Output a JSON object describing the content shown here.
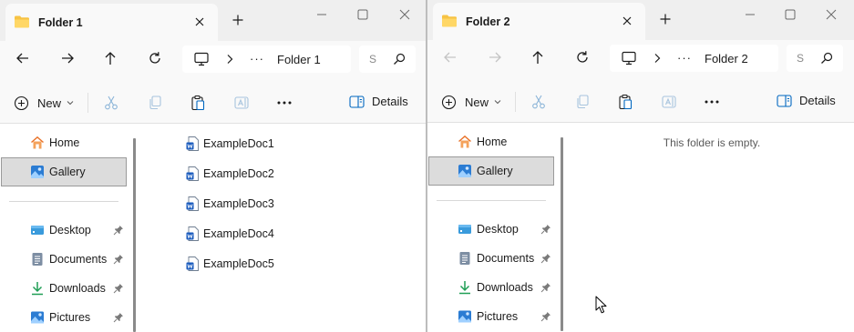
{
  "window1": {
    "tab_title": "Folder 1",
    "breadcrumb_ellipsis": "···",
    "breadcrumb_current": "Folder 1",
    "search_placeholder": "S",
    "new_label": "New",
    "details_label": "Details",
    "nav": {
      "home": "Home",
      "gallery": "Gallery",
      "desktop": "Desktop",
      "documents": "Documents",
      "downloads": "Downloads",
      "pictures": "Pictures"
    },
    "files": [
      "ExampleDoc1",
      "ExampleDoc2",
      "ExampleDoc3",
      "ExampleDoc4",
      "ExampleDoc5"
    ]
  },
  "window2": {
    "tab_title": "Folder 2",
    "breadcrumb_ellipsis": "···",
    "breadcrumb_current": "Folder 2",
    "search_placeholder": "S",
    "new_label": "New",
    "details_label": "Details",
    "nav": {
      "home": "Home",
      "gallery": "Gallery",
      "desktop": "Desktop",
      "documents": "Documents",
      "downloads": "Downloads",
      "pictures": "Pictures"
    },
    "empty_message": "This folder is empty."
  },
  "icons": {
    "folder": "folder-icon",
    "word_doc": "word-document-icon",
    "home": "home-icon",
    "gallery": "gallery-icon",
    "desktop": "desktop-icon",
    "documents": "documents-icon",
    "downloads": "downloads-icon",
    "pictures": "pictures-icon",
    "pin": "pin-icon"
  },
  "colors": {
    "accent": "#0067c0",
    "folder_yellow": "#f7c344",
    "home_orange": "#e9732b",
    "downloads_green": "#1f9e55",
    "selection_bg": "#dcdcdc"
  }
}
